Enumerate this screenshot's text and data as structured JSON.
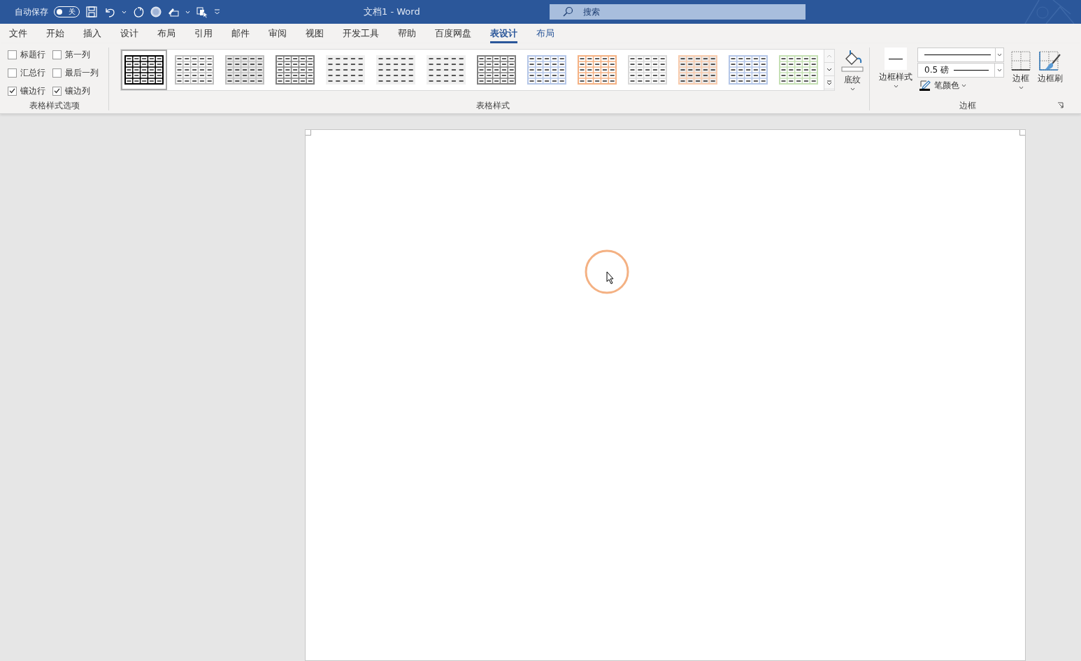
{
  "title_bar": {
    "autosave_label": "自动保存",
    "autosave_toggle": {
      "on": false,
      "text": "关"
    },
    "title": "文档1  -  Word",
    "search": {
      "placeholder": "搜索"
    }
  },
  "tabs": [
    {
      "label": "文件",
      "selected": false,
      "contextual": false
    },
    {
      "label": "开始",
      "selected": false,
      "contextual": false
    },
    {
      "label": "插入",
      "selected": false,
      "contextual": false
    },
    {
      "label": "设计",
      "selected": false,
      "contextual": false
    },
    {
      "label": "布局",
      "selected": false,
      "contextual": false
    },
    {
      "label": "引用",
      "selected": false,
      "contextual": false
    },
    {
      "label": "邮件",
      "selected": false,
      "contextual": false
    },
    {
      "label": "审阅",
      "selected": false,
      "contextual": false
    },
    {
      "label": "视图",
      "selected": false,
      "contextual": false
    },
    {
      "label": "开发工具",
      "selected": false,
      "contextual": false
    },
    {
      "label": "帮助",
      "selected": false,
      "contextual": false
    },
    {
      "label": "百度网盘",
      "selected": false,
      "contextual": false
    },
    {
      "label": "表设计",
      "selected": true,
      "contextual": true
    },
    {
      "label": "布局",
      "selected": false,
      "contextual": true
    }
  ],
  "style_options": {
    "label": "表格样式选项",
    "options": [
      {
        "label": "标题行",
        "checked": false
      },
      {
        "label": "第一列",
        "checked": false
      },
      {
        "label": "汇总行",
        "checked": false
      },
      {
        "label": "最后一列",
        "checked": false
      },
      {
        "label": "镶边行",
        "checked": true
      },
      {
        "label": "镶边列",
        "checked": true
      }
    ]
  },
  "table_styles": {
    "label": "表格样式",
    "items": [
      {
        "kind": "grid",
        "color": "#000000",
        "selected": true
      },
      {
        "kind": "grid",
        "color": "#bfbfbf",
        "selected": false
      },
      {
        "kind": "shaded",
        "color": "#bfbfbf",
        "selected": false
      },
      {
        "kind": "grid",
        "color": "#808080",
        "selected": false
      },
      {
        "kind": "plain",
        "color": "#f0f0f0",
        "selected": false
      },
      {
        "kind": "plain",
        "color": "#f0f0f0",
        "selected": false
      },
      {
        "kind": "plain",
        "color": "#f0f0f0",
        "selected": false
      },
      {
        "kind": "grid",
        "color": "#808080",
        "selected": false
      },
      {
        "kind": "grid",
        "color": "#b4c6e7",
        "selected": false
      },
      {
        "kind": "grid",
        "color": "#f4b183",
        "selected": false
      },
      {
        "kind": "grid",
        "color": "#d9d9d9",
        "selected": false
      },
      {
        "kind": "shaded",
        "color": "#f8cbad",
        "selected": false
      },
      {
        "kind": "grid",
        "color": "#b4c6e7",
        "selected": false
      },
      {
        "kind": "grid",
        "color": "#c5e0b4",
        "selected": false
      }
    ],
    "shading_button": "底纹"
  },
  "borders": {
    "label": "边框",
    "border_styles_button": "边框样式",
    "pen_weight": "0.5 磅",
    "pen_color_button": "笔颜色",
    "borders_button": "边框",
    "border_painter_button": "边框刷"
  }
}
